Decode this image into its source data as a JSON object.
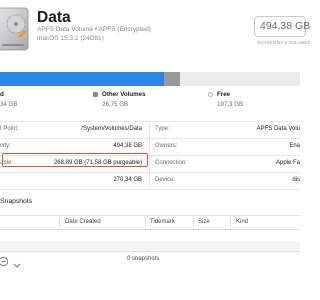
{
  "volume": {
    "title": "Data",
    "subtitle": "APFS Data Volume • APFS (Encrypted)",
    "os": "macOS 15.3.2 (24D81)",
    "capacity_value": "494,38 GB",
    "capacity_label": "SHARED BY 5 VOLUMES"
  },
  "usage": {
    "used_fraction": 0.547,
    "other_fraction": 0.054,
    "free_fraction": 0.399,
    "colors": {
      "used": "#2c86ea",
      "other": "#9a9a9d",
      "free": "#ececee"
    },
    "legend": [
      {
        "label": "d",
        "value": "34 GB"
      },
      {
        "label": "Other Volumes",
        "value": "26,75 GB"
      },
      {
        "label": "Free",
        "value": "197,3 GB"
      }
    ]
  },
  "info": {
    "left": [
      {
        "label": "t Point:",
        "value": "/System/Volumes/Data"
      },
      {
        "label": "city:",
        "value": "494,38 GB"
      },
      {
        "label": "able:",
        "value": "268,89 GB (71,58 GB purgeable)"
      },
      {
        "label": "",
        "value": "270,34 GB"
      }
    ],
    "right": [
      {
        "label": "Type:",
        "value": "APFS Data Volu"
      },
      {
        "label": "Owners:",
        "value": "Ena"
      },
      {
        "label": "Connection:",
        "value": "Apple Fa"
      },
      {
        "label": "Device:",
        "value": "dis"
      }
    ]
  },
  "snapshots": {
    "title": "Snapshots",
    "columns": [
      "Date Created",
      "Tidemark",
      "Size",
      "Kind"
    ],
    "count_text": "0 snapshots"
  }
}
